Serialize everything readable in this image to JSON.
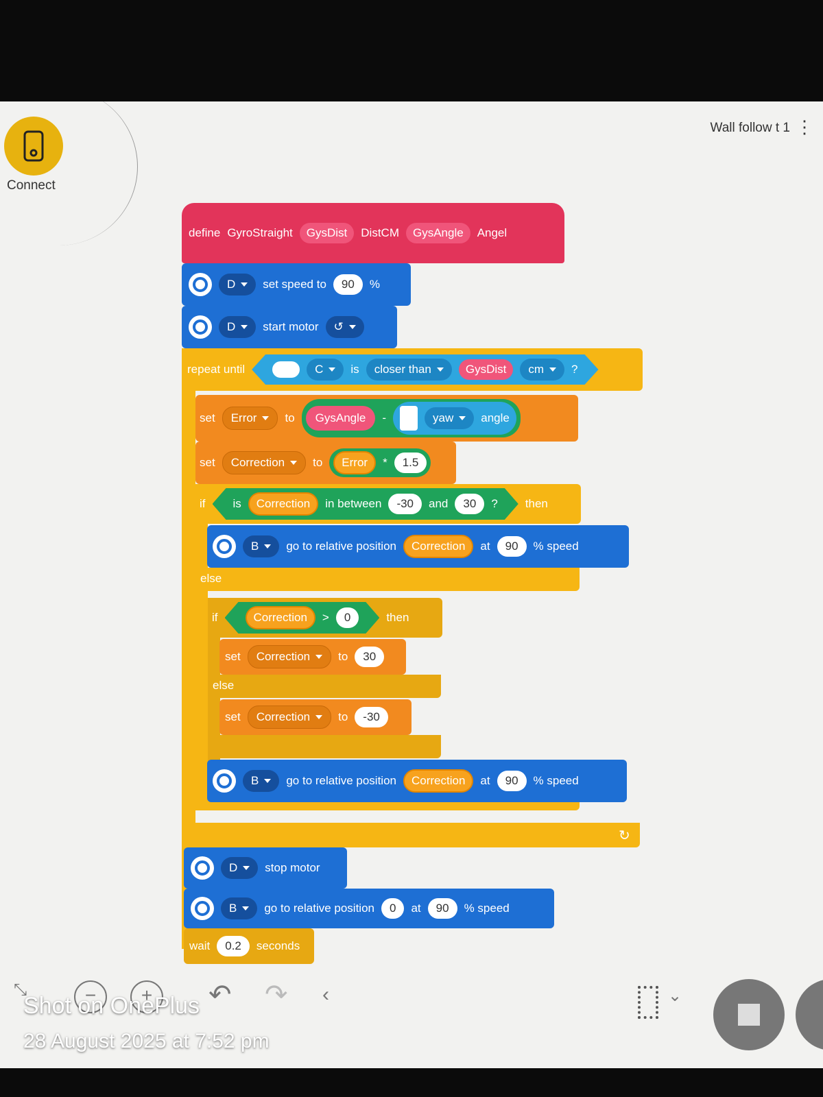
{
  "header": {
    "connect_label": "Connect",
    "project_title": "Wall follow t 1",
    "more_icon": "kebab-icon"
  },
  "define_block": {
    "define": "define",
    "name": "GyroStraight",
    "params": [
      "GysDist",
      "DistCM",
      "GysAngle",
      "Angel"
    ]
  },
  "blocks": {
    "set_speed": {
      "port": "D",
      "label": "set speed to",
      "value": "90",
      "unit": "%"
    },
    "start_motor": {
      "port": "D",
      "label": "start motor"
    },
    "repeat_until": {
      "label": "repeat until",
      "port": "C",
      "is": "is",
      "cond": "closer than",
      "var": "GysDist",
      "unit": "cm",
      "q": "?"
    },
    "set_error": {
      "set": "set",
      "var": "Error",
      "to": "to",
      "a": "GysAngle",
      "op": "-",
      "axis": "yaw",
      "angle": "angle"
    },
    "set_correction": {
      "set": "set",
      "var": "Correction",
      "to": "to",
      "a": "Error",
      "op": "*",
      "b": "1.5"
    },
    "if1": {
      "if": "if",
      "is": "is",
      "var": "Correction",
      "between": "in between",
      "lo": "-30",
      "and": "and",
      "hi": "30",
      "q": "?",
      "then": "then"
    },
    "goto1": {
      "port": "B",
      "label": "go to relative position",
      "var": "Correction",
      "at": "at",
      "speed": "90",
      "unit": "% speed"
    },
    "else1": "else",
    "if2": {
      "if": "if",
      "var": "Correction",
      "op": ">",
      "val": "0",
      "then": "then"
    },
    "set_c30": {
      "set": "set",
      "var": "Correction",
      "to": "to",
      "val": "30"
    },
    "else2": "else",
    "set_cm30": {
      "set": "set",
      "var": "Correction",
      "to": "to",
      "val": "-30"
    },
    "goto2": {
      "port": "B",
      "label": "go to relative position",
      "var": "Correction",
      "at": "at",
      "speed": "90",
      "unit": "% speed"
    },
    "stop_motor": {
      "port": "D",
      "label": "stop motor"
    },
    "goto3": {
      "port": "B",
      "label": "go to relative position",
      "pos": "0",
      "at": "at",
      "speed": "90",
      "unit": "% speed"
    },
    "wait": {
      "label": "wait",
      "value": "0.2",
      "unit": "seconds"
    }
  },
  "watermark": {
    "line1": "Shot on OnePlus",
    "line2": "28 August 2025 at 7:52 pm"
  },
  "colors": {
    "define": "#e2345a",
    "motor": "#1e6fd4",
    "control": "#f6b614",
    "variables": "#f28a1f",
    "operators": "#1fa35a",
    "sensors": "#2ea6df",
    "connect": "#e7b20f"
  }
}
